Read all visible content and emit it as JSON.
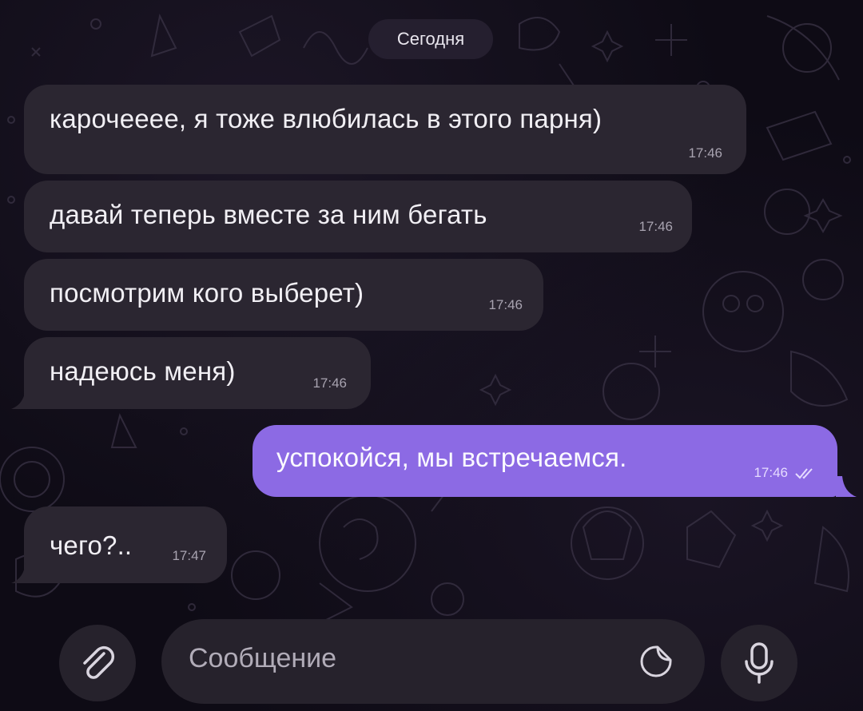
{
  "chat": {
    "date_label": "Сегодня",
    "messages": [
      {
        "text": "карочееее, я тоже влюбилась в этого парня)",
        "time": "17:46",
        "direction": "incoming"
      },
      {
        "text": "давай теперь вместе за ним бегать",
        "time": "17:46",
        "direction": "incoming"
      },
      {
        "text": "посмотрим кого выберет)",
        "time": "17:46",
        "direction": "incoming"
      },
      {
        "text": "надеюсь меня)",
        "time": "17:46",
        "direction": "incoming"
      },
      {
        "text": "успокойся, мы встречаемся.",
        "time": "17:46",
        "direction": "outgoing",
        "status": "read"
      },
      {
        "text": "чего?..",
        "time": "17:47",
        "direction": "incoming"
      }
    ]
  },
  "composer": {
    "placeholder": "Сообщение",
    "attach_icon": "paperclip-icon",
    "sticker_icon": "sticker-icon",
    "mic_icon": "microphone-icon"
  },
  "colors": {
    "incoming_bubble": "#2b2631",
    "outgoing_bubble": "#8c6ae4",
    "background": "#0e0b15"
  }
}
